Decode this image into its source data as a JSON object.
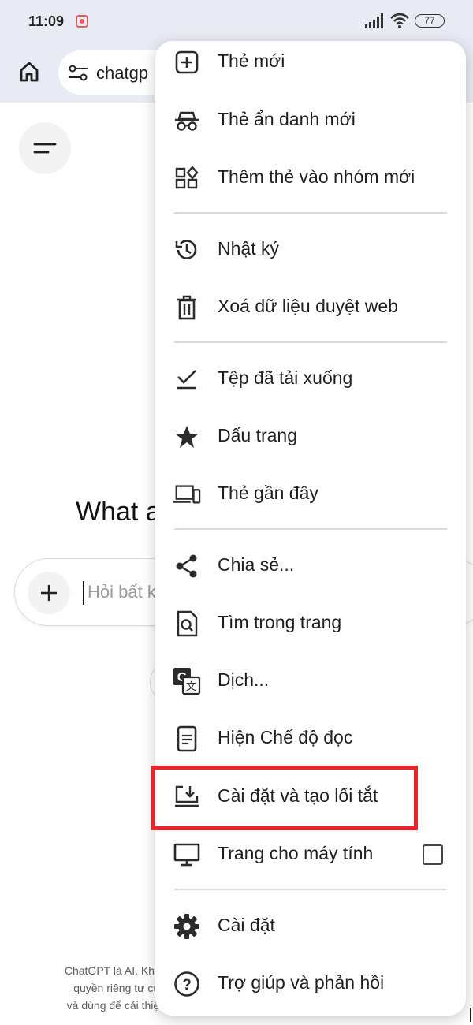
{
  "status_bar": {
    "time": "11:09",
    "battery": "77"
  },
  "toolbar": {
    "url_text": "chatgp"
  },
  "page": {
    "heading": "What a",
    "input_placeholder": "Hỏi bất k",
    "footer_line1": "ChatGPT là AI. Khi s",
    "footer_line2_link": "quyền riêng tư",
    "footer_line2_rest": " của",
    "footer_line3": "và dùng để cải thiện"
  },
  "menu": {
    "items": [
      {
        "label": "Thẻ mới",
        "icon": "new-tab-icon"
      },
      {
        "label": "Thẻ ẩn danh mới",
        "icon": "incognito-icon"
      },
      {
        "label": "Thêm thẻ vào nhóm mới",
        "icon": "tab-group-icon"
      },
      {
        "label": "Nhật ký",
        "icon": "history-icon"
      },
      {
        "label": "Xoá dữ liệu duyệt web",
        "icon": "trash-icon"
      },
      {
        "label": "Tệp đã tải xuống",
        "icon": "downloads-icon"
      },
      {
        "label": "Dấu trang",
        "icon": "star-icon"
      },
      {
        "label": "Thẻ gần đây",
        "icon": "devices-icon"
      },
      {
        "label": "Chia sẻ...",
        "icon": "share-icon"
      },
      {
        "label": "Tìm trong trang",
        "icon": "find-in-page-icon"
      },
      {
        "label": "Dịch...",
        "icon": "translate-icon"
      },
      {
        "label": "Hiện Chế độ đọc",
        "icon": "reader-mode-icon"
      },
      {
        "label": "Cài đặt và tạo lối tắt",
        "icon": "install-shortcut-icon"
      },
      {
        "label": "Trang cho máy tính",
        "icon": "desktop-icon"
      },
      {
        "label": "Cài đặt",
        "icon": "gear-icon"
      },
      {
        "label": "Trợ giúp và phản hồi",
        "icon": "help-icon"
      }
    ],
    "desktop_site_checked": false
  },
  "highlight_color": "#e8252a"
}
